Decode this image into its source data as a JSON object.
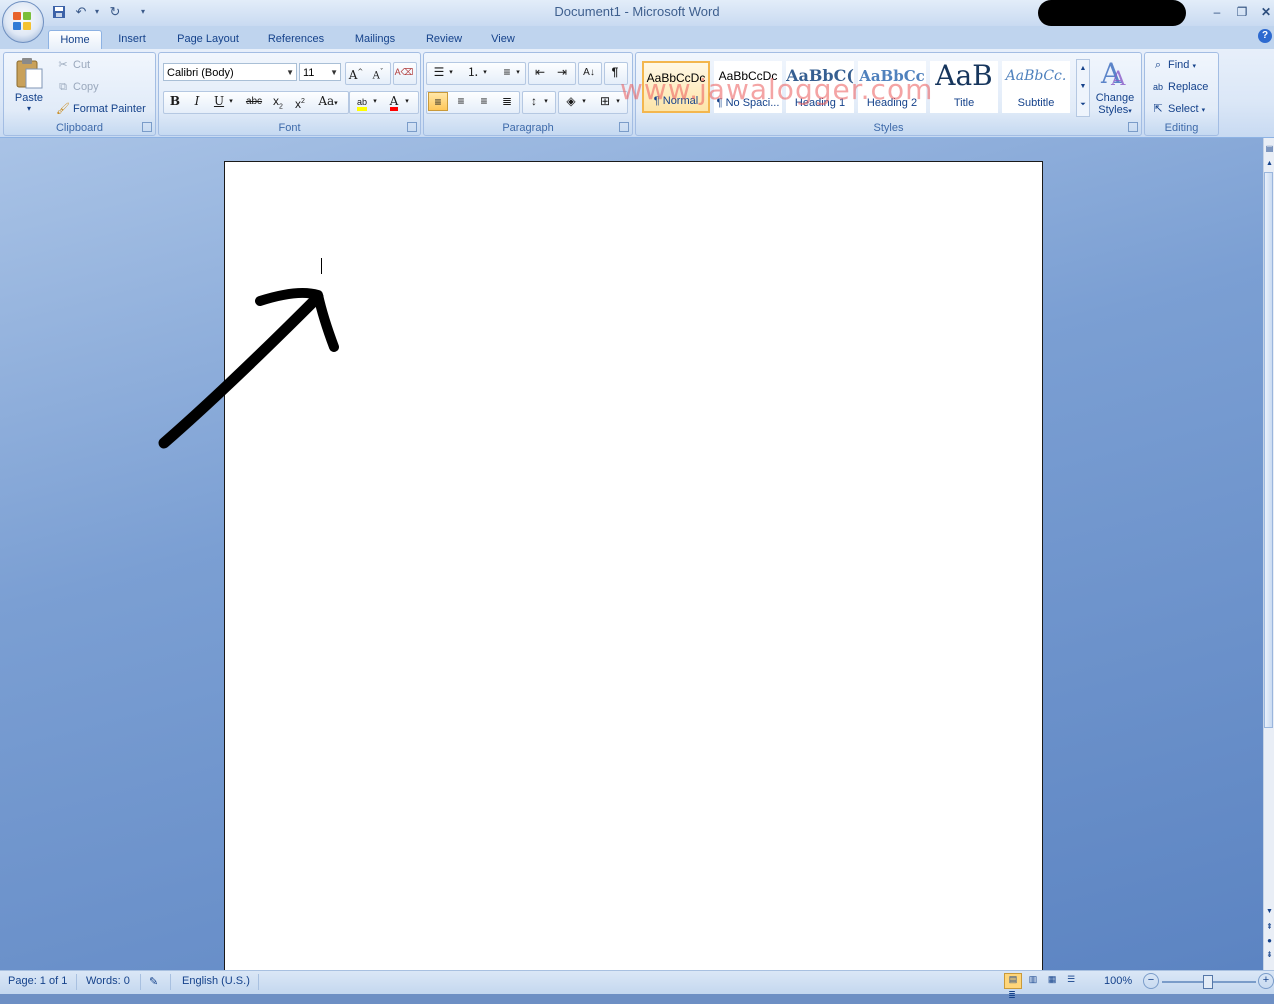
{
  "window": {
    "title": "Document1 - Microsoft Word"
  },
  "quick_access": {
    "icons": [
      "save-icon",
      "undo-icon",
      "redo-icon",
      "customize-icon"
    ]
  },
  "tabs": [
    {
      "label": "Home",
      "active": true
    },
    {
      "label": "Insert"
    },
    {
      "label": "Page Layout"
    },
    {
      "label": "References"
    },
    {
      "label": "Mailings"
    },
    {
      "label": "Review"
    },
    {
      "label": "View"
    }
  ],
  "clipboard": {
    "group": "Clipboard",
    "paste": "Paste",
    "cut": "Cut",
    "copy": "Copy",
    "format_painter": "Format Painter"
  },
  "font": {
    "group": "Font",
    "family": "Calibri (Body)",
    "size": "11",
    "change_case": "Aa"
  },
  "paragraph": {
    "group": "Paragraph"
  },
  "styles": {
    "group": "Styles",
    "items": [
      {
        "sample": "AaBbCcDc",
        "label": "¶ Normal",
        "selected": true
      },
      {
        "sample": "AaBbCcDc",
        "label": "¶ No Spaci..."
      },
      {
        "sample": "AaBbC(",
        "label": "Heading 1"
      },
      {
        "sample": "AaBbCc",
        "label": "Heading 2"
      },
      {
        "sample": "AaB",
        "label": "Title"
      },
      {
        "sample": "AaBbCc.",
        "label": "Subtitle"
      }
    ],
    "change_styles_line1": "Change",
    "change_styles_line2": "Styles"
  },
  "editing": {
    "group": "Editing",
    "find": "Find",
    "replace": "Replace",
    "select": "Select"
  },
  "watermark": "www.jawalogger.com",
  "status": {
    "page": "Page: 1 of 1",
    "words": "Words: 0",
    "language": "English (U.S.)",
    "zoom": "100%"
  },
  "colors": {
    "highlight": "#ffff00",
    "font_color": "#ff0000",
    "accent": "#15428b"
  }
}
